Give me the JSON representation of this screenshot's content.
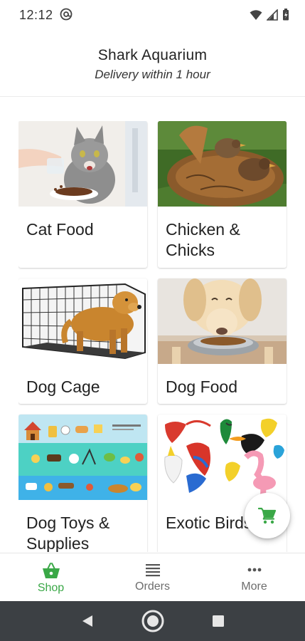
{
  "status_bar": {
    "time": "12:12"
  },
  "header": {
    "title": "Shark Aquarium",
    "subtitle": "Delivery within 1 hour"
  },
  "categories": [
    {
      "label": "Cat Food"
    },
    {
      "label": "Chicken & Chicks"
    },
    {
      "label": "Dog Cage"
    },
    {
      "label": "Dog Food"
    },
    {
      "label": "Dog Toys & Supplies"
    },
    {
      "label": "Exotic Birds"
    }
  ],
  "bottom_nav": [
    {
      "label": "Shop",
      "icon": "basket-icon",
      "active": true
    },
    {
      "label": "Orders",
      "icon": "list-icon",
      "active": false
    },
    {
      "label": "More",
      "icon": "more-icon",
      "active": false
    }
  ],
  "colors": {
    "accent": "#3aa847",
    "nav_inactive": "#6d6d6d",
    "system_nav_bg": "#3c4044"
  }
}
